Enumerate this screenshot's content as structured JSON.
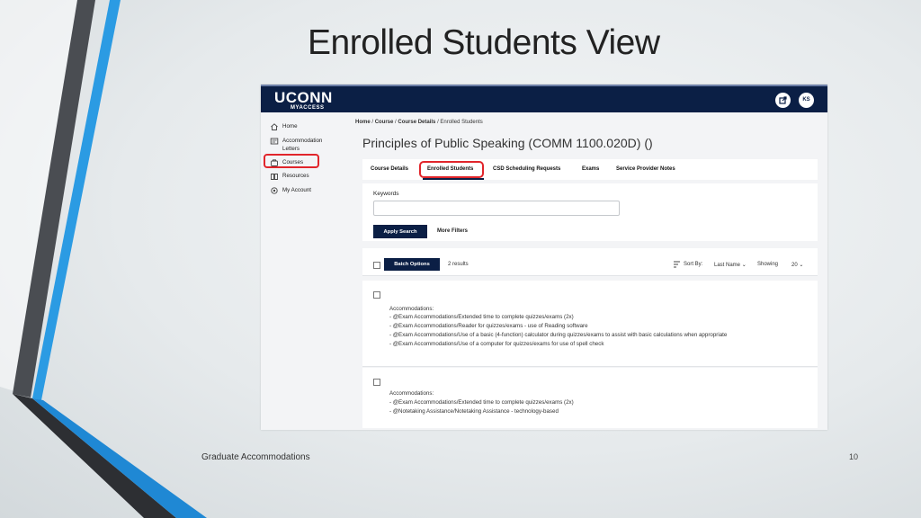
{
  "slide": {
    "title": "Enrolled Students View",
    "footer": "Graduate Accommodations",
    "page_number": "10"
  },
  "app": {
    "logo": "UCONN",
    "logo_sub": "MYACCESS",
    "avatar_initials": "KS",
    "header_bg": "#0b1f45",
    "highlight_color": "#e1252b"
  },
  "sidebar": {
    "items": [
      {
        "label": "Home",
        "icon": "home-icon"
      },
      {
        "label": "Accommodation Letters",
        "icon": "letter-icon"
      },
      {
        "label": "Courses",
        "icon": "courses-icon",
        "highlighted": true
      },
      {
        "label": "Resources",
        "icon": "resources-icon"
      },
      {
        "label": "My Account",
        "icon": "gear-icon"
      }
    ]
  },
  "breadcrumb": {
    "items": [
      "Home",
      "Course",
      "Course Details",
      "Enrolled Students"
    ],
    "separator": "/"
  },
  "course": {
    "title": "Principles of Public Speaking (COMM 1100.020D) ()"
  },
  "tabs": [
    {
      "label": "Course Details"
    },
    {
      "label": "Enrolled Students",
      "active": true
    },
    {
      "label": "CSD Scheduling Requests"
    },
    {
      "label": "Exams"
    },
    {
      "label": "Service Provider Notes"
    }
  ],
  "search": {
    "keywords_label": "Keywords",
    "keywords_value": "",
    "apply_label": "Apply Search",
    "more_filters_label": "More Filters"
  },
  "results": {
    "batch_label": "Batch Options",
    "count_text": "2 results",
    "sort_label": "Sort By:",
    "sort_value": "Last Name",
    "showing_label": "Showing",
    "showing_value": "20"
  },
  "students": [
    {
      "heading": "Accommodations:",
      "accommodations": [
        "- @Exam Accommodations/Extended time to complete quizzes/exams (2x)",
        "- @Exam Accommodations/Reader for quizzes/exams - use of Reading software",
        "- @Exam Accommodations/Use of a basic (4-function) calculator during quizzes/exams to assist with basic calculations when appropriate",
        "- @Exam Accommodations/Use of a computer for quizzes/exams for use of spell check"
      ]
    },
    {
      "heading": "Accommodations:",
      "accommodations": [
        "- @Exam Accommodations/Extended time to complete quizzes/exams (2x)",
        "- @Notetaking Assistance/Notetaking Assistance - technology-based"
      ]
    }
  ]
}
